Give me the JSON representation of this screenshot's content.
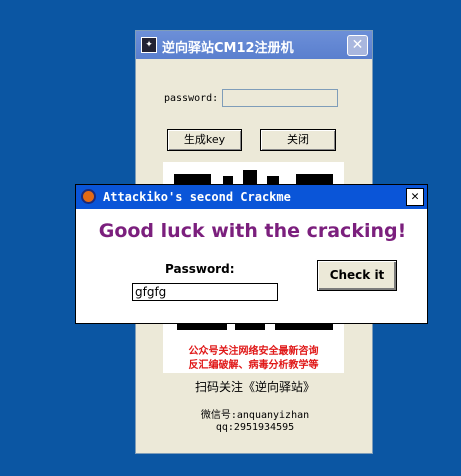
{
  "main_window": {
    "title": "逆向驿站CM12注册机",
    "title_icon": "app-icon",
    "close_glyph": "✕",
    "password_label": "password:",
    "password_value": "",
    "generate_button": "生成key",
    "close_button": "关闭",
    "promo_line1": "公众号关注网络安全最新咨询",
    "promo_line2": "反汇编破解、病毒分析教学等",
    "scan_text": "扫码关注《逆向驿站》",
    "wechat_text": "微信号:anquanyizhan",
    "qq_text": "qq:2951934595"
  },
  "crackme_window": {
    "title": "Attackiko's second Crackme",
    "close_glyph": "✕",
    "headline": "Good luck with the cracking!",
    "password_label": "Password:",
    "password_value": "gfgfg",
    "check_button": "Check it"
  },
  "colors": {
    "desktop": "#0b56a3",
    "headline": "#7b1f7d",
    "promo": "#e01818",
    "titlebar_active": "#0a55d8"
  }
}
